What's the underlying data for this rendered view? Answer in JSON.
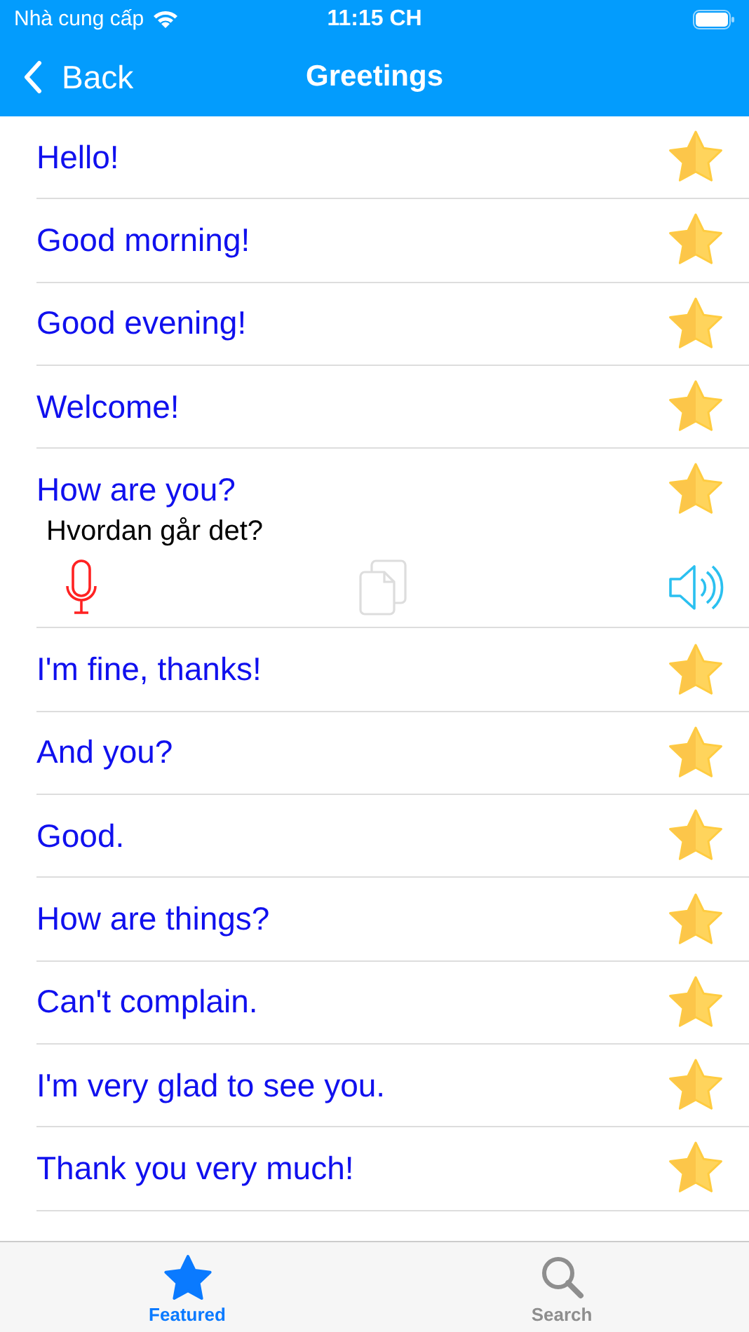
{
  "status_bar": {
    "carrier": "Nhà cung cấp",
    "time": "11:15 CH"
  },
  "nav": {
    "back": "Back",
    "title": "Greetings"
  },
  "phrases": [
    {
      "text": "Hello!",
      "favorite": true,
      "expanded": false
    },
    {
      "text": "Good morning!",
      "favorite": true,
      "expanded": false
    },
    {
      "text": "Good evening!",
      "favorite": true,
      "expanded": false
    },
    {
      "text": "Welcome!",
      "favorite": true,
      "expanded": false
    },
    {
      "text": "How are you?",
      "favorite": true,
      "expanded": true,
      "translation": "Hvordan går det?"
    },
    {
      "text": "I'm fine, thanks!",
      "favorite": true,
      "expanded": false
    },
    {
      "text": "And you?",
      "favorite": true,
      "expanded": false
    },
    {
      "text": "Good.",
      "favorite": true,
      "expanded": false
    },
    {
      "text": "How are things?",
      "favorite": true,
      "expanded": false
    },
    {
      "text": "Can't complain.",
      "favorite": true,
      "expanded": false
    },
    {
      "text": "I'm very glad to see you.",
      "favorite": true,
      "expanded": false
    },
    {
      "text": "Thank you very much!",
      "favorite": true,
      "expanded": false
    }
  ],
  "tabs": [
    {
      "label": "Featured",
      "kind": "star",
      "selected": true
    },
    {
      "label": "Search",
      "kind": "search",
      "selected": false
    }
  ]
}
